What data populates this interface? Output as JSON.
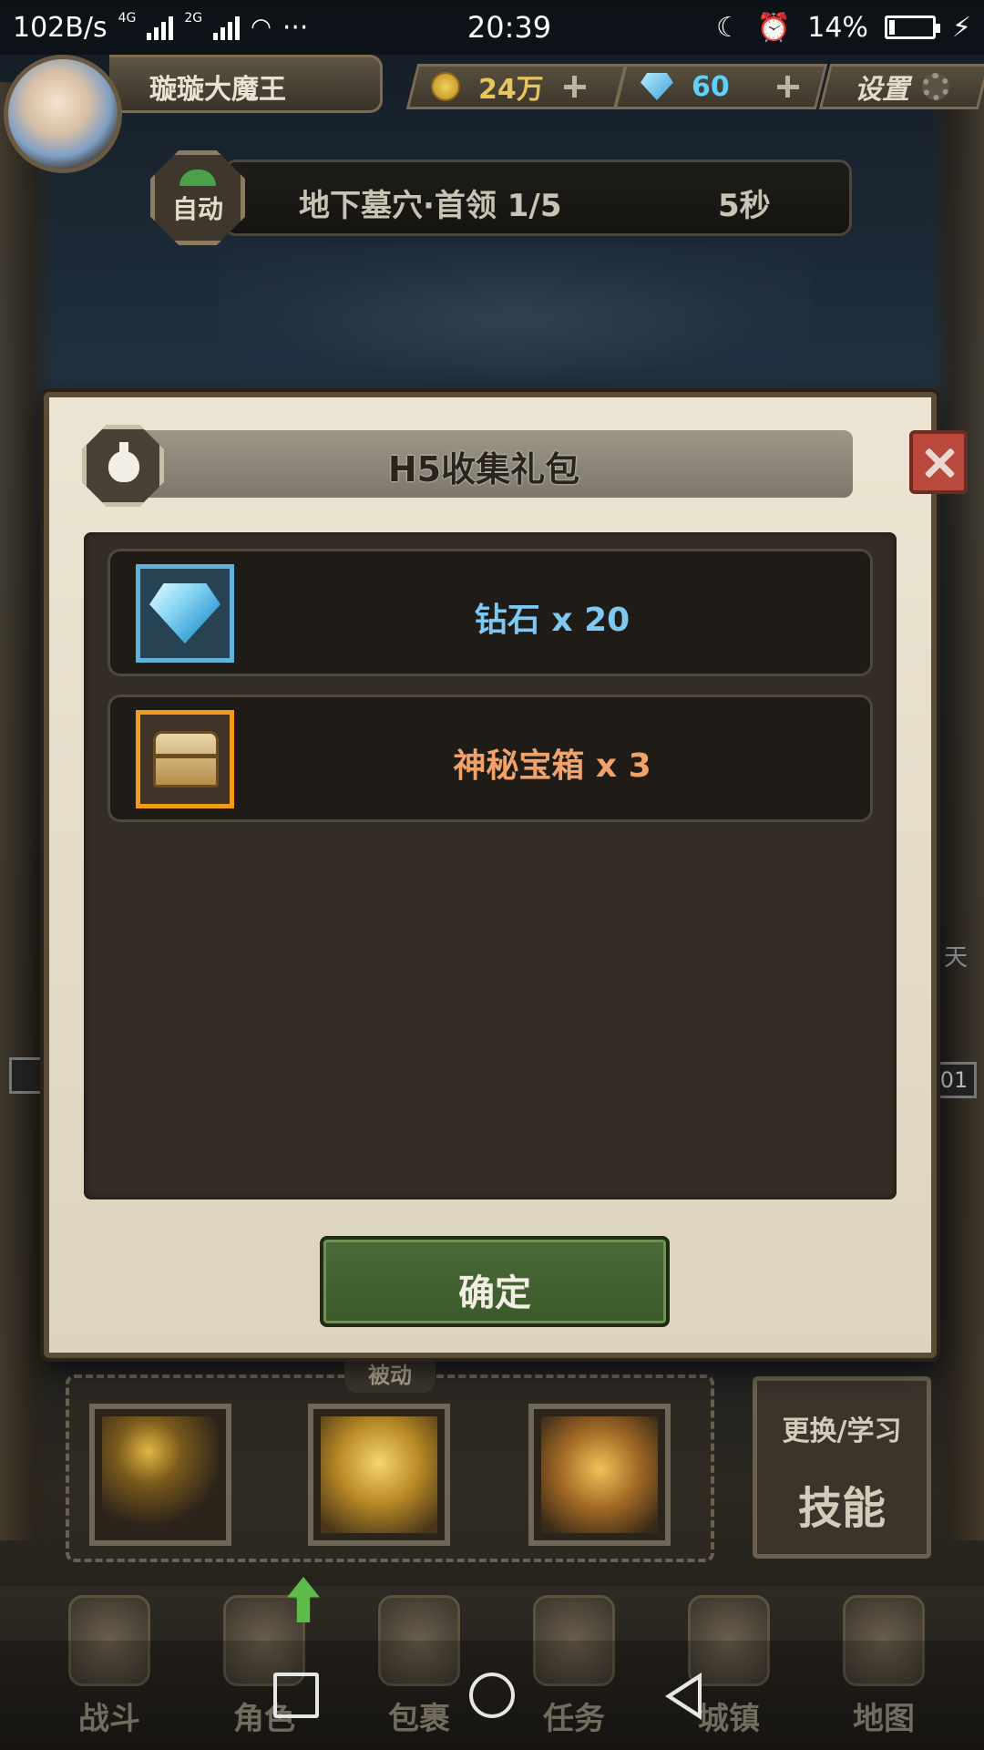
{
  "status_bar": {
    "net_speed": "102B/s",
    "sig1_label": "4G",
    "sig2_label": "2G",
    "more": "···",
    "time": "20:39",
    "battery": "14%",
    "battery_level": 0.14
  },
  "hud": {
    "player_name": "璇璇大魔王",
    "gold": "24万",
    "diamonds": "60",
    "settings_label": "设置"
  },
  "stage": {
    "auto_label": "自动",
    "name": "地下墓穴·首领  1/5",
    "timer": "5秒"
  },
  "scene": {
    "side_text": "天",
    "side_num": "01"
  },
  "modal": {
    "title": "H5收集礼包",
    "rewards": [
      {
        "icon": "diamond-icon",
        "text": "钻石 x 20",
        "color": "#7fc8f2"
      },
      {
        "icon": "treasure-chest-icon",
        "text": "神秘宝箱 x 3",
        "color": "#f0a26a"
      }
    ],
    "confirm_label": "确定"
  },
  "skills": {
    "passive_label": "被动",
    "change_top": "更换/学习",
    "change_main": "技能"
  },
  "bottom_nav": {
    "items": [
      {
        "label": "战斗"
      },
      {
        "label": "角色"
      },
      {
        "label": "包裹"
      },
      {
        "label": "任务"
      },
      {
        "label": "城镇"
      },
      {
        "label": "地图"
      }
    ]
  }
}
